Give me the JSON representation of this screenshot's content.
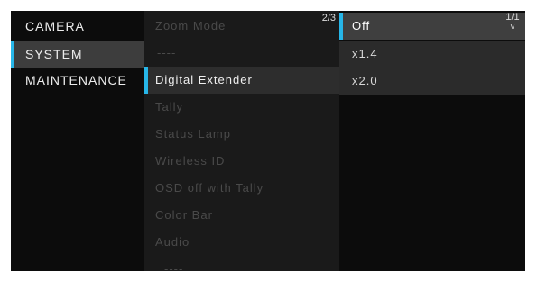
{
  "main_menu": {
    "items": [
      {
        "label": "CAMERA"
      },
      {
        "label": "SYSTEM"
      },
      {
        "label": "MAINTENANCE"
      }
    ]
  },
  "sub_menu": {
    "page_indicator": "2/3",
    "items": [
      {
        "label": "Zoom Mode"
      },
      {
        "label": "----"
      },
      {
        "label": "Digital Extender"
      },
      {
        "label": "Tally"
      },
      {
        "label": "Status Lamp"
      },
      {
        "label": "Wireless ID"
      },
      {
        "label": "OSD off with Tally"
      },
      {
        "label": "Color Bar"
      },
      {
        "label": "Audio"
      },
      {
        "label": "----"
      }
    ]
  },
  "options": {
    "page_indicator": "1/1",
    "scroll_icon": "chevron-down-icon",
    "items": [
      {
        "label": "Off"
      },
      {
        "label": "x1.4"
      },
      {
        "label": "x2.0"
      }
    ]
  },
  "colors": {
    "accent": "#27b6e8",
    "background": "#0c0c0c",
    "disabled_text": "#4a4a4a"
  }
}
